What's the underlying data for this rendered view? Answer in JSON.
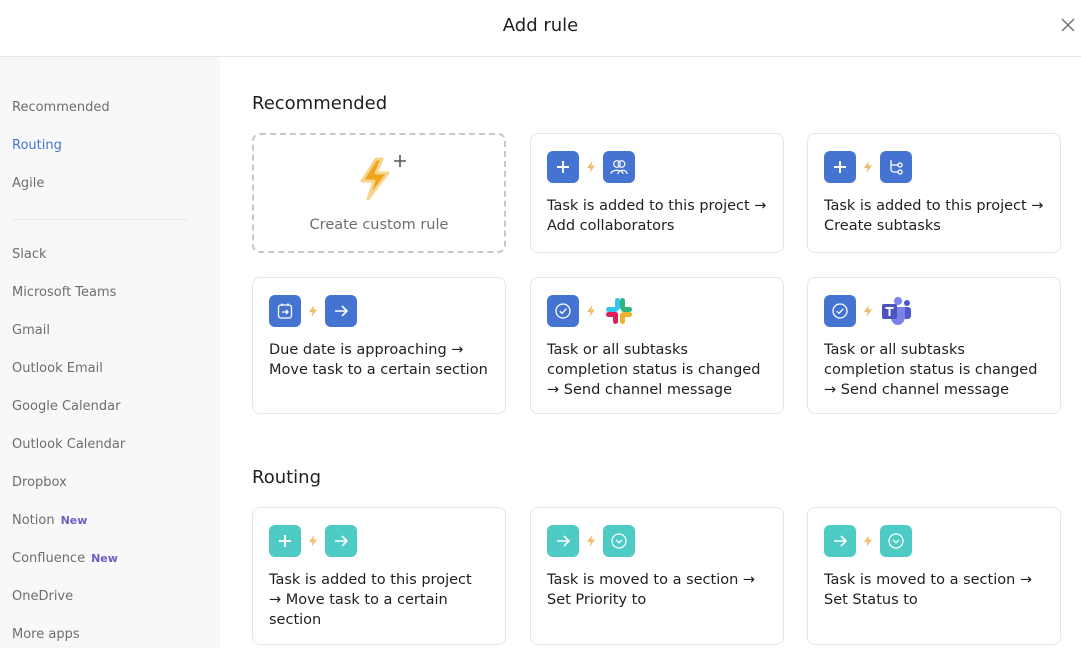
{
  "header": {
    "title": "Add rule",
    "close_icon": "close-icon"
  },
  "sidebar": {
    "items": [
      {
        "label": "Recommended",
        "active": false
      },
      {
        "label": "Routing",
        "active": true
      },
      {
        "label": "Agile",
        "active": false
      },
      {
        "label": "Slack"
      },
      {
        "label": "Microsoft Teams"
      },
      {
        "label": "Gmail"
      },
      {
        "label": "Outlook Email"
      },
      {
        "label": "Google Calendar"
      },
      {
        "label": "Outlook Calendar"
      },
      {
        "label": "Dropbox"
      },
      {
        "label": "Notion",
        "badge": "New"
      },
      {
        "label": "Confluence",
        "badge": "New"
      },
      {
        "label": "OneDrive"
      },
      {
        "label": "More apps"
      }
    ]
  },
  "sections": {
    "recommended": {
      "title": "Recommended",
      "custom_rule_label": "Create custom rule",
      "cards": [
        {
          "trigger_icon": "plus-icon",
          "action_icon": "collaborators-icon",
          "text": "Task is added to this project → Add collaborators"
        },
        {
          "trigger_icon": "plus-icon",
          "action_icon": "subtasks-icon",
          "text": "Task is added to this project → Create subtasks"
        },
        {
          "trigger_icon": "calendar-arrow-icon",
          "action_icon": "arrow-right-icon",
          "text": "Due date is approaching → Move task to a certain section"
        },
        {
          "trigger_icon": "check-circle-icon",
          "action_icon": "slack-icon",
          "text": "Task or all subtasks completion status is changed → Send channel message"
        },
        {
          "trigger_icon": "check-circle-icon",
          "action_icon": "teams-icon",
          "text": "Task or all subtasks completion status is changed → Send channel message"
        }
      ]
    },
    "routing": {
      "title": "Routing",
      "cards": [
        {
          "trigger_icon": "plus-icon",
          "action_icon": "arrow-right-icon",
          "text": "Task is added to this project → Move task to a certain section"
        },
        {
          "trigger_icon": "arrow-right-icon",
          "action_icon": "chevron-circle-icon",
          "text": "Task is moved to a section → Set Priority to"
        },
        {
          "trigger_icon": "arrow-right-icon",
          "action_icon": "chevron-circle-icon",
          "text": "Task is moved to a section → Set Status to"
        }
      ]
    }
  },
  "colors": {
    "accent_blue": "#4573d2",
    "accent_teal": "#4ecbc4",
    "bolt": "#f1bd6c",
    "active_nav": "#4573d2",
    "badge": "#6d5fc4"
  }
}
